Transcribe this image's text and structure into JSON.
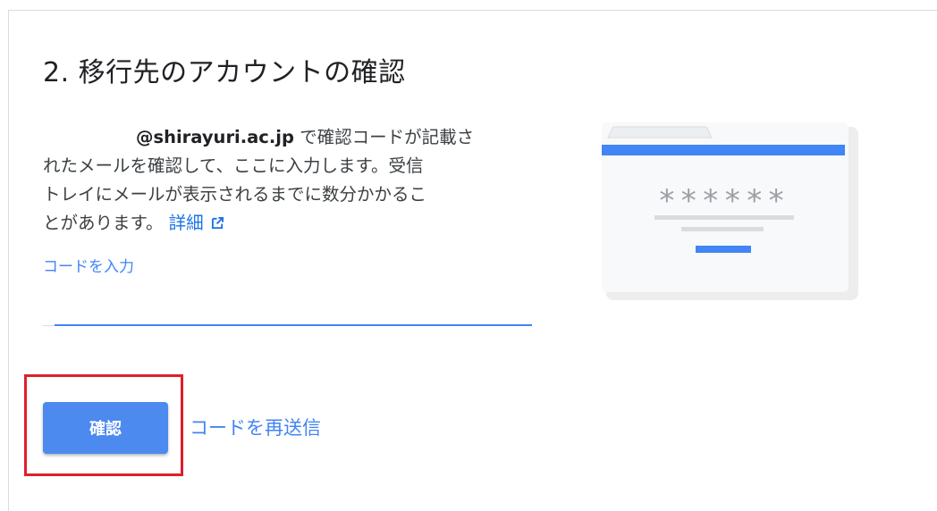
{
  "title": "2. 移行先のアカウントの確認",
  "description": {
    "email": "@shirayuri.ac.jp",
    "text_line1": " で確認コードが記載さ",
    "text_line2": "れたメールを確認して、ここに入力します。受信",
    "text_line3": "トレイにメールが表示されるまでに数分かかるこ",
    "text_line4": "とがあります。",
    "more_link": "詳細"
  },
  "code_field": {
    "label": "コードを入力",
    "value": ""
  },
  "illustration": {
    "masked_code": "******"
  },
  "actions": {
    "confirm_label": "確認",
    "resend_label": "コードを再送信"
  },
  "colors": {
    "accent": "#4285f4",
    "button": "#4d8af0",
    "highlight_border": "#e01e2b"
  },
  "icons": [
    "external-link-icon"
  ]
}
